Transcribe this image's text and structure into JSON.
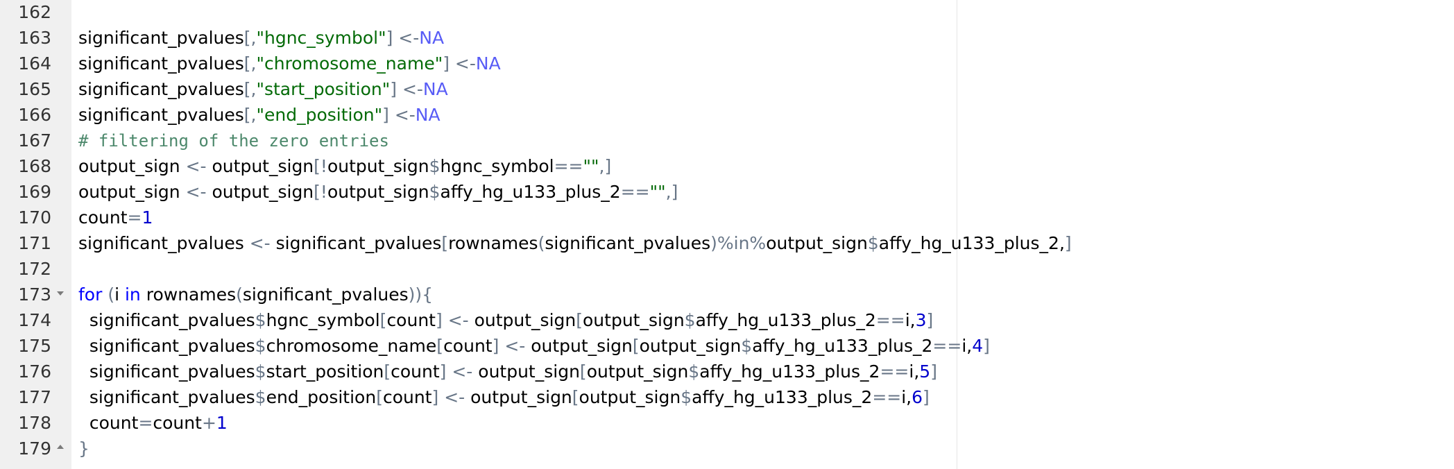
{
  "lines": [
    {
      "number": "162",
      "fold": "",
      "tokens": []
    },
    {
      "number": "163",
      "fold": "",
      "tokens": [
        {
          "t": "significant_pvalues",
          "c": "id"
        },
        {
          "t": "[,",
          "c": "op"
        },
        {
          "t": "\"hgnc_symbol\"",
          "c": "str"
        },
        {
          "t": "] ",
          "c": "op"
        },
        {
          "t": "<-",
          "c": "op"
        },
        {
          "t": "NA",
          "c": "na"
        }
      ]
    },
    {
      "number": "164",
      "fold": "",
      "tokens": [
        {
          "t": "significant_pvalues",
          "c": "id"
        },
        {
          "t": "[,",
          "c": "op"
        },
        {
          "t": "\"chromosome_name\"",
          "c": "str"
        },
        {
          "t": "] ",
          "c": "op"
        },
        {
          "t": "<-",
          "c": "op"
        },
        {
          "t": "NA",
          "c": "na"
        }
      ]
    },
    {
      "number": "165",
      "fold": "",
      "tokens": [
        {
          "t": "significant_pvalues",
          "c": "id"
        },
        {
          "t": "[,",
          "c": "op"
        },
        {
          "t": "\"start_position\"",
          "c": "str"
        },
        {
          "t": "] ",
          "c": "op"
        },
        {
          "t": "<-",
          "c": "op"
        },
        {
          "t": "NA",
          "c": "na"
        }
      ]
    },
    {
      "number": "166",
      "fold": "",
      "tokens": [
        {
          "t": "significant_pvalues",
          "c": "id"
        },
        {
          "t": "[,",
          "c": "op"
        },
        {
          "t": "\"end_position\"",
          "c": "str"
        },
        {
          "t": "] ",
          "c": "op"
        },
        {
          "t": "<-",
          "c": "op"
        },
        {
          "t": "NA",
          "c": "na"
        }
      ]
    },
    {
      "number": "167",
      "fold": "",
      "tokens": [
        {
          "t": "# filtering of the zero entries",
          "c": "cmt"
        }
      ]
    },
    {
      "number": "168",
      "fold": "",
      "tokens": [
        {
          "t": "output_sign ",
          "c": "id"
        },
        {
          "t": "<-",
          "c": "op"
        },
        {
          "t": " output_sign",
          "c": "id"
        },
        {
          "t": "[!",
          "c": "op"
        },
        {
          "t": "output_sign",
          "c": "id"
        },
        {
          "t": "$",
          "c": "op"
        },
        {
          "t": "hgnc_symbol",
          "c": "id"
        },
        {
          "t": "==",
          "c": "op"
        },
        {
          "t": "\"\"",
          "c": "str"
        },
        {
          "t": ",]",
          "c": "op"
        }
      ]
    },
    {
      "number": "169",
      "fold": "",
      "tokens": [
        {
          "t": "output_sign ",
          "c": "id"
        },
        {
          "t": "<-",
          "c": "op"
        },
        {
          "t": " output_sign",
          "c": "id"
        },
        {
          "t": "[!",
          "c": "op"
        },
        {
          "t": "output_sign",
          "c": "id"
        },
        {
          "t": "$",
          "c": "op"
        },
        {
          "t": "affy_hg_u133_plus_2",
          "c": "id"
        },
        {
          "t": "==",
          "c": "op"
        },
        {
          "t": "\"\"",
          "c": "str"
        },
        {
          "t": ",]",
          "c": "op"
        }
      ]
    },
    {
      "number": "170",
      "fold": "",
      "tokens": [
        {
          "t": "count",
          "c": "id"
        },
        {
          "t": "=",
          "c": "op"
        },
        {
          "t": "1",
          "c": "num"
        }
      ]
    },
    {
      "number": "171",
      "fold": "",
      "tokens": [
        {
          "t": "significant_pvalues ",
          "c": "id"
        },
        {
          "t": "<-",
          "c": "op"
        },
        {
          "t": " significant_pvalues",
          "c": "id"
        },
        {
          "t": "[",
          "c": "op"
        },
        {
          "t": "rownames",
          "c": "id"
        },
        {
          "t": "(",
          "c": "op"
        },
        {
          "t": "significant_pvalues",
          "c": "id"
        },
        {
          "t": ")%in%",
          "c": "op"
        },
        {
          "t": "output_sign",
          "c": "id"
        },
        {
          "t": "$",
          "c": "op"
        },
        {
          "t": "affy_hg_u133_plus_2,",
          "c": "id"
        },
        {
          "t": "]",
          "c": "op"
        }
      ]
    },
    {
      "number": "172",
      "fold": "",
      "tokens": []
    },
    {
      "number": "173",
      "fold": "open",
      "tokens": [
        {
          "t": "for",
          "c": "kw"
        },
        {
          "t": " (",
          "c": "op"
        },
        {
          "t": "i ",
          "c": "id"
        },
        {
          "t": "in",
          "c": "kw"
        },
        {
          "t": " rownames",
          "c": "id"
        },
        {
          "t": "(",
          "c": "op"
        },
        {
          "t": "significant_pvalues",
          "c": "id"
        },
        {
          "t": ")){",
          "c": "op"
        }
      ]
    },
    {
      "number": "174",
      "fold": "",
      "tokens": [
        {
          "t": "  significant_pvalues",
          "c": "id"
        },
        {
          "t": "$",
          "c": "op"
        },
        {
          "t": "hgnc_symbol",
          "c": "id"
        },
        {
          "t": "[",
          "c": "op"
        },
        {
          "t": "count",
          "c": "id"
        },
        {
          "t": "] ",
          "c": "op"
        },
        {
          "t": "<-",
          "c": "op"
        },
        {
          "t": " output_sign",
          "c": "id"
        },
        {
          "t": "[",
          "c": "op"
        },
        {
          "t": "output_sign",
          "c": "id"
        },
        {
          "t": "$",
          "c": "op"
        },
        {
          "t": "affy_hg_u133_plus_2",
          "c": "id"
        },
        {
          "t": "==",
          "c": "op"
        },
        {
          "t": "i,",
          "c": "id"
        },
        {
          "t": "3",
          "c": "num"
        },
        {
          "t": "]",
          "c": "op"
        }
      ]
    },
    {
      "number": "175",
      "fold": "",
      "tokens": [
        {
          "t": "  significant_pvalues",
          "c": "id"
        },
        {
          "t": "$",
          "c": "op"
        },
        {
          "t": "chromosome_name",
          "c": "id"
        },
        {
          "t": "[",
          "c": "op"
        },
        {
          "t": "count",
          "c": "id"
        },
        {
          "t": "] ",
          "c": "op"
        },
        {
          "t": "<-",
          "c": "op"
        },
        {
          "t": " output_sign",
          "c": "id"
        },
        {
          "t": "[",
          "c": "op"
        },
        {
          "t": "output_sign",
          "c": "id"
        },
        {
          "t": "$",
          "c": "op"
        },
        {
          "t": "affy_hg_u133_plus_2",
          "c": "id"
        },
        {
          "t": "==",
          "c": "op"
        },
        {
          "t": "i,",
          "c": "id"
        },
        {
          "t": "4",
          "c": "num"
        },
        {
          "t": "]",
          "c": "op"
        }
      ]
    },
    {
      "number": "176",
      "fold": "",
      "tokens": [
        {
          "t": "  significant_pvalues",
          "c": "id"
        },
        {
          "t": "$",
          "c": "op"
        },
        {
          "t": "start_position",
          "c": "id"
        },
        {
          "t": "[",
          "c": "op"
        },
        {
          "t": "count",
          "c": "id"
        },
        {
          "t": "] ",
          "c": "op"
        },
        {
          "t": "<-",
          "c": "op"
        },
        {
          "t": " output_sign",
          "c": "id"
        },
        {
          "t": "[",
          "c": "op"
        },
        {
          "t": "output_sign",
          "c": "id"
        },
        {
          "t": "$",
          "c": "op"
        },
        {
          "t": "affy_hg_u133_plus_2",
          "c": "id"
        },
        {
          "t": "==",
          "c": "op"
        },
        {
          "t": "i,",
          "c": "id"
        },
        {
          "t": "5",
          "c": "num"
        },
        {
          "t": "]",
          "c": "op"
        }
      ]
    },
    {
      "number": "177",
      "fold": "",
      "tokens": [
        {
          "t": "  significant_pvalues",
          "c": "id"
        },
        {
          "t": "$",
          "c": "op"
        },
        {
          "t": "end_position",
          "c": "id"
        },
        {
          "t": "[",
          "c": "op"
        },
        {
          "t": "count",
          "c": "id"
        },
        {
          "t": "] ",
          "c": "op"
        },
        {
          "t": "<-",
          "c": "op"
        },
        {
          "t": " output_sign",
          "c": "id"
        },
        {
          "t": "[",
          "c": "op"
        },
        {
          "t": "output_sign",
          "c": "id"
        },
        {
          "t": "$",
          "c": "op"
        },
        {
          "t": "affy_hg_u133_plus_2",
          "c": "id"
        },
        {
          "t": "==",
          "c": "op"
        },
        {
          "t": "i,",
          "c": "id"
        },
        {
          "t": "6",
          "c": "num"
        },
        {
          "t": "]",
          "c": "op"
        }
      ]
    },
    {
      "number": "178",
      "fold": "",
      "tokens": [
        {
          "t": "  count",
          "c": "id"
        },
        {
          "t": "=",
          "c": "op"
        },
        {
          "t": "count",
          "c": "id"
        },
        {
          "t": "+",
          "c": "op"
        },
        {
          "t": "1",
          "c": "num"
        }
      ]
    },
    {
      "number": "179",
      "fold": "close",
      "tokens": [
        {
          "t": "}",
          "c": "op"
        }
      ]
    }
  ]
}
